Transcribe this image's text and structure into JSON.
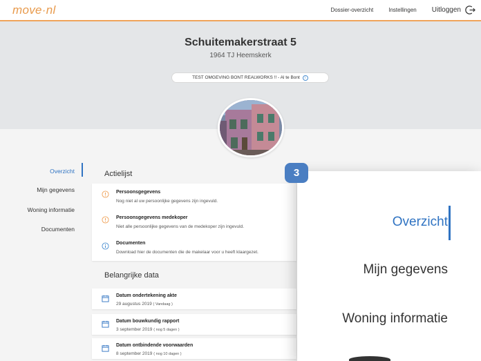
{
  "header": {
    "logo": {
      "name": "move",
      "dot": "·",
      "suffix": "nl"
    },
    "nav": [
      "Dossier-overzicht",
      "Instellingen"
    ],
    "logout_label": "Uitloggen"
  },
  "property": {
    "address": "Schuitemakerstraat 5",
    "postal": "1964 TJ Heemskerk",
    "environment_label": "TEST OMGEVING BONT REALWORKS !! - Al te Bont",
    "info_glyph": "i"
  },
  "sidebar": {
    "items": [
      "Overzicht",
      "Mijn gegevens",
      "Woning informatie",
      "Documenten"
    ],
    "active_index": 0
  },
  "actions": {
    "title": "Actielijst",
    "items": [
      {
        "title": "Persoonsgegevens",
        "text": "Nog niet al uw persoonlijke gegevens zijn ingevuld.",
        "icon": "warning-icon"
      },
      {
        "title": "Persoonsgegevens medekoper",
        "text": "Niet alle persoonlijke gegevens van de medekoper zijn ingevuld.",
        "icon": "warning-icon"
      },
      {
        "title": "Documenten",
        "text": "Download hier de documenten die de makelaar voor u heeft klaargezet.",
        "icon": "info-icon"
      }
    ]
  },
  "dates": {
    "title": "Belangrijke data",
    "items": [
      {
        "title": "Datum ondertekening akte",
        "date": "29 augustus 2019",
        "tag": "( Vandaag )"
      },
      {
        "title": "Datum bouwkundig rapport",
        "date": "3 september 2019",
        "tag": "( nog 5 dagen )"
      },
      {
        "title": "Datum ontbindende voorwaarden",
        "date": "8 september 2019",
        "tag": "( nog 10 dagen )"
      }
    ]
  },
  "zoom": {
    "step": "3",
    "items": [
      "Overzicht",
      "Mijn gegevens",
      "Woning informatie"
    ]
  },
  "colors": {
    "accent_orange": "#e89a4c",
    "active_blue": "#2f73c2",
    "badge_blue": "#4a7ec2",
    "warning": "#f0a35a",
    "info": "#4b8fd1"
  }
}
